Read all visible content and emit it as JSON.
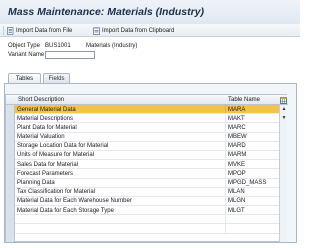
{
  "window": {
    "title": "Mass Maintenance: Materials (Industry)"
  },
  "toolbar": {
    "import_file_label": "Import Data from File",
    "import_clipboard_label": "Import Data from Clipboard"
  },
  "header": {
    "object_type_label": "Object Type",
    "object_type_code": "BUS1001",
    "object_type_desc": "Materials (Industry)",
    "variant_name_label": "Variant Name",
    "variant_name_value": ""
  },
  "tabs": [
    {
      "label": "Tables",
      "active": true
    },
    {
      "label": "Fields",
      "active": false
    }
  ],
  "table": {
    "columns": [
      "Short Description",
      "Table Name"
    ],
    "rows": [
      {
        "desc": "General Material Data",
        "name": "MARA",
        "selected": true
      },
      {
        "desc": "Material Descriptions",
        "name": "MAKT",
        "selected": false
      },
      {
        "desc": "Plant Data for Material",
        "name": "MARC",
        "selected": false
      },
      {
        "desc": "Material Valuation",
        "name": "MBEW",
        "selected": false
      },
      {
        "desc": "Storage Location Data for Material",
        "name": "MARD",
        "selected": false
      },
      {
        "desc": "Units of Measure for Material",
        "name": "MARM",
        "selected": false
      },
      {
        "desc": "Sales Data for Material",
        "name": "MVKE",
        "selected": false
      },
      {
        "desc": "Forecast Parameters",
        "name": "MPOP",
        "selected": false
      },
      {
        "desc": "Planning Data",
        "name": "MPGD_MASS",
        "selected": false
      },
      {
        "desc": "Tax Classification for Material",
        "name": "MLAN",
        "selected": false
      },
      {
        "desc": "Material Data for Each Warehouse Number",
        "name": "MLGN",
        "selected": false
      },
      {
        "desc": "Material Data for Each Storage Type",
        "name": "MLGT",
        "selected": false
      }
    ],
    "empty_rows": 2
  },
  "icons": {
    "import_file": "import-file-icon",
    "import_clipboard": "import-clipboard-icon",
    "table_settings": "table-settings-icon",
    "scroll_up": "scroll-up-icon",
    "scroll_down": "scroll-down-icon"
  },
  "colors": {
    "title_text": "#1b2f4c",
    "selected_row": "#f2c44a",
    "header_bg": "#dfe8f1"
  }
}
